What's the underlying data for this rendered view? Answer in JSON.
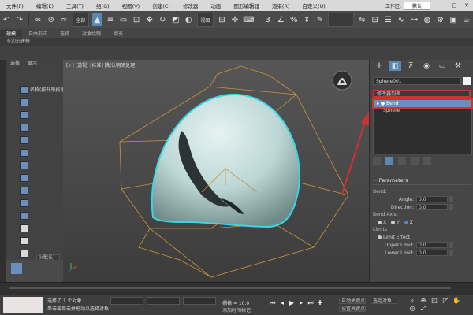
{
  "menubar": {
    "items": [
      "文件(F)",
      "编辑(E)",
      "工具(T)",
      "组(G)",
      "视图(V)",
      "创建(C)",
      "修改器",
      "动画",
      "图形编辑器",
      "渲染(R)",
      "自定义(U)"
    ],
    "workspace": "工作区:",
    "workspace_value": "默认"
  },
  "toolbar": {
    "select_filter": "全部",
    "view_dd": "视图"
  },
  "ribbon": {
    "tabs": [
      "建模",
      "自由形式",
      "选择",
      "对象绘制",
      "填充"
    ],
    "subrow": "多边形建模"
  },
  "scene": {
    "tabs": [
      "选择",
      "显示"
    ],
    "row_label": "名称(按升序排序)",
    "layer_value": "0(默认)"
  },
  "viewport": {
    "label": "[+] [透视] [标准] [默认明暗处理]",
    "colors": {
      "sphere": "#bcd7d6",
      "outline": "#39d7e6",
      "wire": "#c9953a"
    }
  },
  "cmdpanel": {
    "object_name": "Sphere001",
    "modifier_list": "修改器列表",
    "stack": [
      {
        "label": "▸ ● Bend",
        "selected": true
      },
      {
        "label": "Sphere",
        "selected": false
      }
    ],
    "params_header": "Parameters",
    "bend_group": "Bend:",
    "angle_label": "Angle:",
    "angle_value": "0.0",
    "direction_label": "Direction:",
    "direction_value": "0.0",
    "axis_group": "Bend Axis:",
    "axes": [
      "X",
      "Y",
      "Z"
    ],
    "limits_group": "Limits",
    "limit_effect": "Limit Effect",
    "upper_label": "Upper Limit:",
    "upper_value": "0.0",
    "lower_label": "Lower Limit:",
    "lower_value": "0.0"
  },
  "status": {
    "selected": "选择了 1 个对象",
    "hint": "单击或单击并拖动以选择对象",
    "grid": "栅格 = 10.0",
    "add_time_tag": "添加时间标记",
    "auto_key": "自动关键点",
    "set_key": "设置关键点",
    "selection_dd": "选定对象"
  }
}
